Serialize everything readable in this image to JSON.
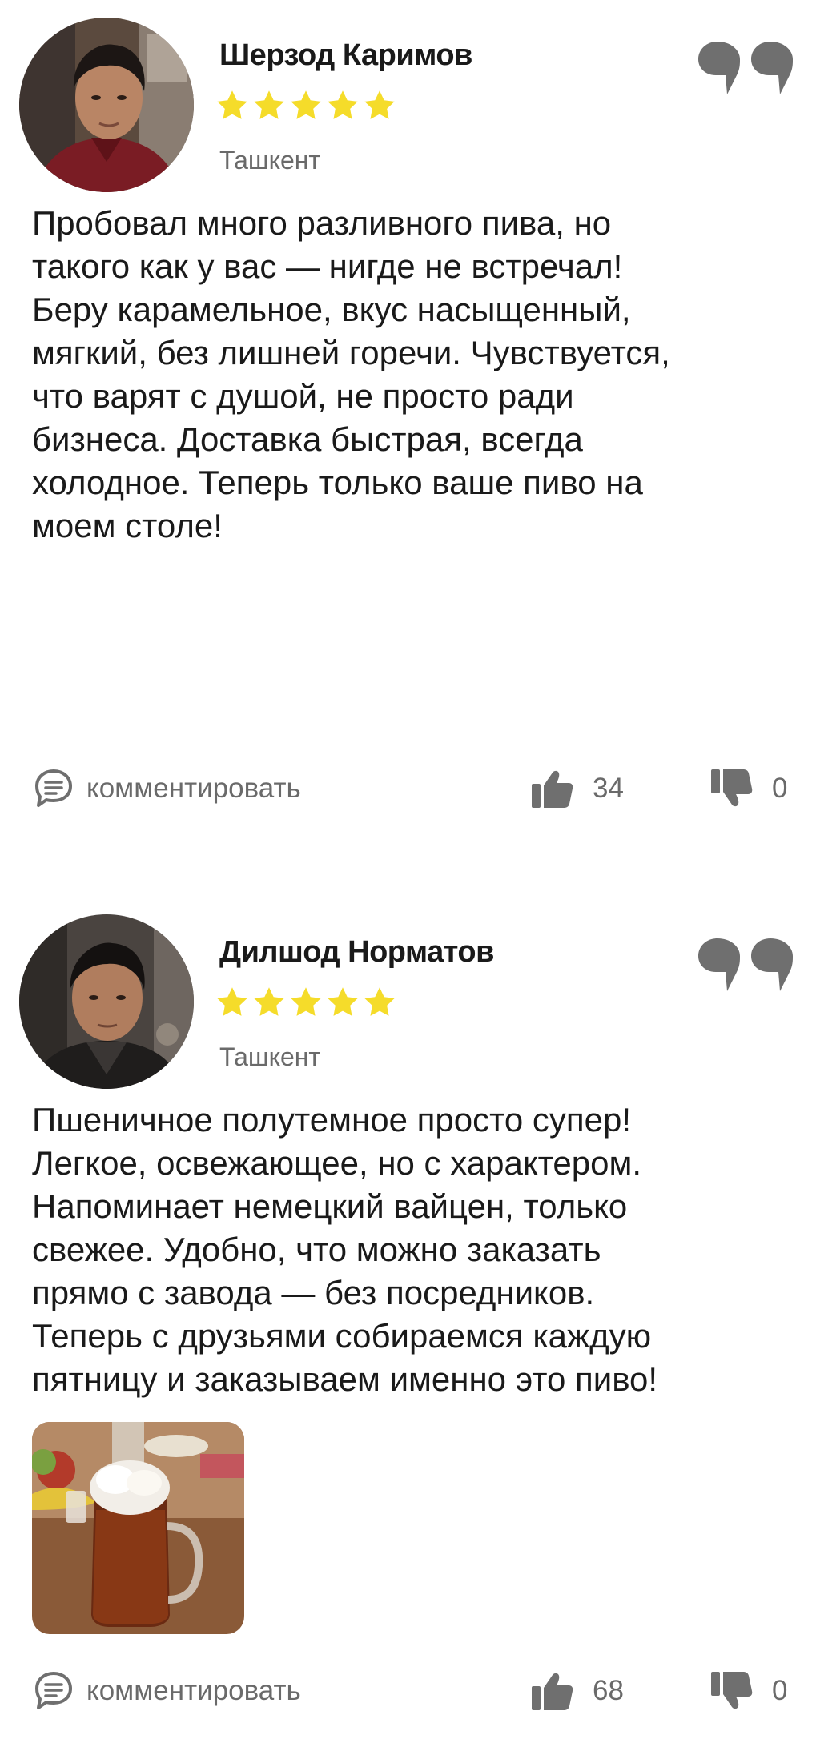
{
  "reviews": [
    {
      "author": "Шерзод Каримов",
      "rating": 5,
      "city": "Ташкент",
      "text": "Пробовал много разливного пива, но\nтакого как у вас — нигде не встречал!\nБеру карамельное, вкус насыщенный,\nмягкий, без лишней горечи. Чувствуется,\nчто варят с душой, не просто ради\nбизнеса. Доставка быстрая, всегда\nхолодное. Теперь только ваше пиво на\nмоем столе!",
      "comment_label": "комментировать",
      "likes": "34",
      "dislikes": "0",
      "has_photo": false
    },
    {
      "author": "Дилшод Норматов",
      "rating": 5,
      "city": "Ташкент",
      "text": "Пшеничное полутемное просто супер!\nЛегкое, освежающее, но с характером.\nНапоминает немецкий вайцен, только\nсвежее. Удобно, что можно заказать\nпрямо с завода — без посредников.\nТеперь с друзьями собираемся каждую\nпятницу и заказываем именно это пиво!",
      "comment_label": "комментировать",
      "likes": "68",
      "dislikes": "0",
      "has_photo": true
    }
  ],
  "icons": {
    "star": "star-icon",
    "quote": "quote-icon",
    "comment": "comment-icon",
    "like": "thumbs-up-icon",
    "dislike": "thumbs-down-icon"
  },
  "colors": {
    "star": "#F5DC2A",
    "icon_gray": "#6f6f6f",
    "text": "#1a1a1a",
    "muted": "#6a6a6a"
  }
}
